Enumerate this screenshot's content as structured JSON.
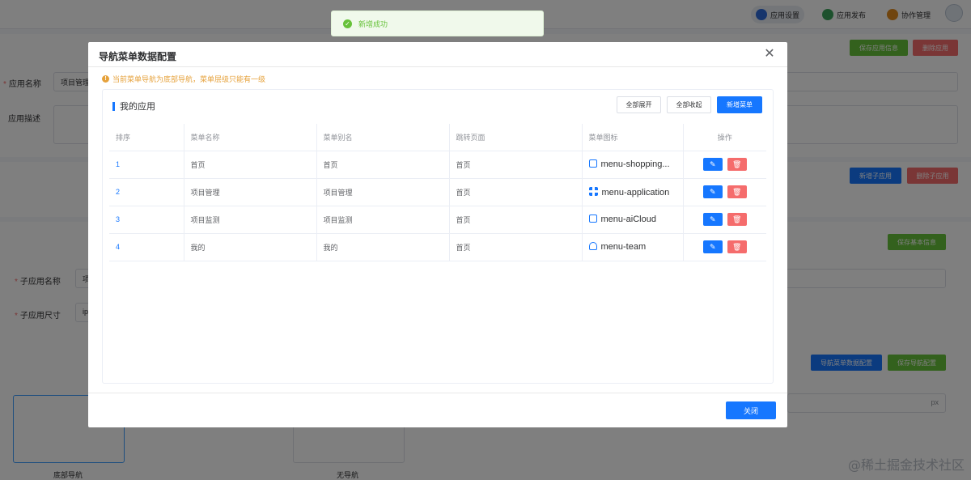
{
  "toast": {
    "message": "新增成功"
  },
  "topbar": {
    "actions": [
      {
        "label": "应用设置",
        "color": "#2f6bd8"
      },
      {
        "label": "应用发布",
        "color": "#3aa35a"
      },
      {
        "label": "协作管理",
        "color": "#e08a1e"
      }
    ]
  },
  "background": {
    "buttons": {
      "save_app_info": "保存应用信息",
      "delete_app": "删除应用",
      "add_sub_app": "新增子应用",
      "delete_sub_app": "删除子应用",
      "save_basic_info": "保存基本信息",
      "nav_menu_config": "导航菜单数据配置",
      "save_nav_config": "保存导航配置"
    },
    "fields": {
      "app_name_label": "应用名称",
      "app_name_value": "项目管理",
      "app_desc_label": "应用描述",
      "sub_app_name_label": "子应用名称",
      "sub_app_name_value": "项",
      "sub_app_size_label": "子应用尺寸",
      "sub_app_size_value": "ip",
      "unit": "px"
    },
    "layouts": [
      {
        "label": "底部导航"
      },
      {
        "label": "无导航"
      }
    ],
    "watermark": "@稀土掘金技术社区"
  },
  "dialog": {
    "title": "导航菜单数据配置",
    "tip": "当前菜单导航为底部导航，菜单层级只能有一级",
    "panel_title": "我的应用",
    "buttons": {
      "expand_all": "全部展开",
      "collapse_all": "全部收起",
      "add_menu": "新增菜单",
      "close": "关闭"
    },
    "table": {
      "headers": [
        "排序",
        "菜单名称",
        "菜单别名",
        "跳转页面",
        "菜单图标",
        "操作"
      ],
      "rows": [
        {
          "order": "1",
          "name": "首页",
          "alias": "首页",
          "page": "首页",
          "icon": "menu-shopping...",
          "icon_type": "shop"
        },
        {
          "order": "2",
          "name": "项目管理",
          "alias": "项目管理",
          "page": "首页",
          "icon": "menu-application",
          "icon_type": "grid"
        },
        {
          "order": "3",
          "name": "项目监测",
          "alias": "项目监测",
          "page": "首页",
          "icon": "menu-aiCloud",
          "icon_type": "cloud"
        },
        {
          "order": "4",
          "name": "我的",
          "alias": "我的",
          "page": "首页",
          "icon": "menu-team",
          "icon_type": "team"
        }
      ]
    }
  }
}
